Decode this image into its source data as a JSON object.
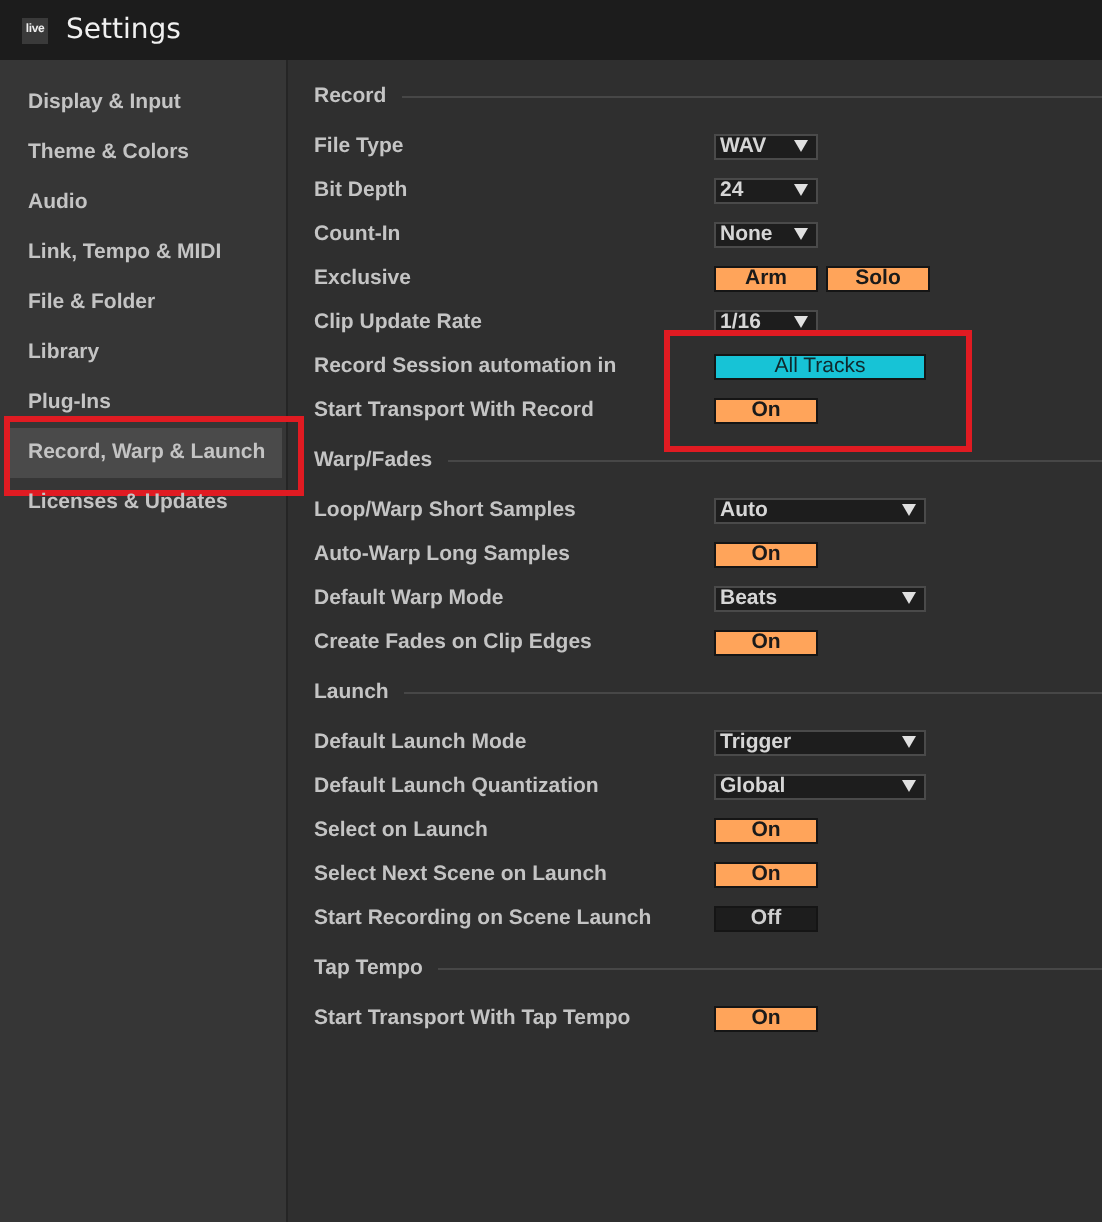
{
  "window": {
    "logo_text": "live",
    "title": "Settings"
  },
  "sidebar": {
    "items": [
      {
        "label": "Display & Input",
        "selected": false,
        "annotated": false
      },
      {
        "label": "Theme & Colors",
        "selected": false,
        "annotated": false
      },
      {
        "label": "Audio",
        "selected": false,
        "annotated": false
      },
      {
        "label": "Link, Tempo & MIDI",
        "selected": false,
        "annotated": false
      },
      {
        "label": "File & Folder",
        "selected": false,
        "annotated": false
      },
      {
        "label": "Library",
        "selected": false,
        "annotated": false
      },
      {
        "label": "Plug-Ins",
        "selected": false,
        "annotated": false
      },
      {
        "label": "Record, Warp & Launch",
        "selected": true,
        "annotated": true
      },
      {
        "label": "Licenses & Updates",
        "selected": false,
        "annotated": false
      }
    ]
  },
  "sections": [
    {
      "title": "Record",
      "rows": [
        {
          "label": "File Type",
          "kind": "dropdown",
          "value": "WAV",
          "wide": false,
          "annotated": false
        },
        {
          "label": "Bit Depth",
          "kind": "dropdown",
          "value": "24",
          "wide": false,
          "annotated": false
        },
        {
          "label": "Count-In",
          "kind": "dropdown",
          "value": "None",
          "wide": false,
          "annotated": false
        },
        {
          "label": "Exclusive",
          "kind": "toggle_pair",
          "toggles": [
            {
              "label": "Arm",
              "on": true
            },
            {
              "label": "Solo",
              "on": true
            }
          ],
          "annotated": false
        },
        {
          "label": "Clip Update Rate",
          "kind": "dropdown",
          "value": "1/16",
          "wide": false,
          "annotated": false
        },
        {
          "label": "Record Session automation in",
          "kind": "chooser",
          "value": "All Tracks",
          "annotated": true
        },
        {
          "label": "Start Transport With Record",
          "kind": "toggle",
          "value": "On",
          "on": true,
          "annotated": true
        }
      ]
    },
    {
      "title": "Warp/Fades",
      "rows": [
        {
          "label": "Loop/Warp Short Samples",
          "kind": "dropdown",
          "value": "Auto",
          "wide": true,
          "annotated": false
        },
        {
          "label": "Auto-Warp Long Samples",
          "kind": "toggle",
          "value": "On",
          "on": true,
          "annotated": false
        },
        {
          "label": "Default Warp Mode",
          "kind": "dropdown",
          "value": "Beats",
          "wide": true,
          "annotated": false
        },
        {
          "label": "Create Fades on Clip Edges",
          "kind": "toggle",
          "value": "On",
          "on": true,
          "annotated": false
        }
      ]
    },
    {
      "title": "Launch",
      "rows": [
        {
          "label": "Default Launch Mode",
          "kind": "dropdown",
          "value": "Trigger",
          "wide": true,
          "annotated": false
        },
        {
          "label": "Default Launch Quantization",
          "kind": "dropdown",
          "value": "Global",
          "wide": true,
          "annotated": false
        },
        {
          "label": "Select on Launch",
          "kind": "toggle",
          "value": "On",
          "on": true,
          "annotated": false
        },
        {
          "label": "Select Next Scene on Launch",
          "kind": "toggle",
          "value": "On",
          "on": true,
          "annotated": false
        },
        {
          "label": "Start Recording on Scene Launch",
          "kind": "toggle",
          "value": "Off",
          "on": false,
          "annotated": false
        }
      ]
    },
    {
      "title": "Tap Tempo",
      "rows": [
        {
          "label": "Start Transport With Tap Tempo",
          "kind": "toggle",
          "value": "On",
          "on": true,
          "annotated": false
        }
      ]
    }
  ]
}
